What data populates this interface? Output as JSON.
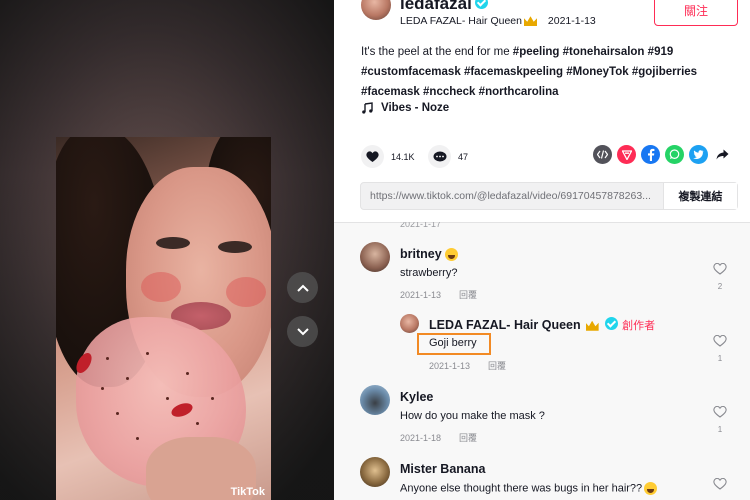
{
  "video": {
    "watermark": "TikTok"
  },
  "header": {
    "username": "ledafazal",
    "display_name": "LEDA FAZAL- Hair Queen",
    "date": "2021-1-13",
    "follow_label": "關注"
  },
  "caption": {
    "text_before": "It's the peel at the end for me ",
    "hashtags": [
      "#peeling",
      "#tonehairsalon",
      "#919",
      "#customfacemask",
      "#facemaskpeeling",
      "#MoneyTok",
      "#gojiberries",
      "#facemask",
      "#nccheck",
      "#northcarolina"
    ]
  },
  "music": {
    "title": "Vibes - Noze"
  },
  "actions": {
    "likes": "14.1K",
    "comments": "47"
  },
  "share_icons": [
    "embed-icon",
    "send-icon",
    "facebook-icon",
    "whatsapp-icon",
    "twitter-icon",
    "share-arrow-icon"
  ],
  "colors": {
    "accent": "#fe2c55",
    "facebook": "#1877f2",
    "whatsapp": "#25d366",
    "twitter": "#1da1f2",
    "highlight": "#f28a24"
  },
  "link": {
    "url": "https://www.tiktok.com/@ledafazal/video/69170457878263...",
    "copy_label": "複製連結"
  },
  "comments": {
    "partial_meta": "2021-1-17",
    "items": [
      {
        "name": "britney",
        "text": "strawberry?",
        "date": "2021-1-13",
        "reply": "回覆",
        "likes": "2"
      },
      {
        "name": "LEDA FAZAL- Hair Queen",
        "creator": "創作者",
        "text": "Goji berry",
        "date": "2021-1-13",
        "reply": "回覆",
        "likes": "1"
      },
      {
        "name": "Kylee",
        "text": "How do you make the mask ?",
        "date": "2021-1-18",
        "reply": "回覆",
        "likes": "1"
      },
      {
        "name": "Mister Banana",
        "text": "Anyone else thought there was bugs in her hair??",
        "date": "",
        "reply": "",
        "likes": ""
      }
    ]
  }
}
